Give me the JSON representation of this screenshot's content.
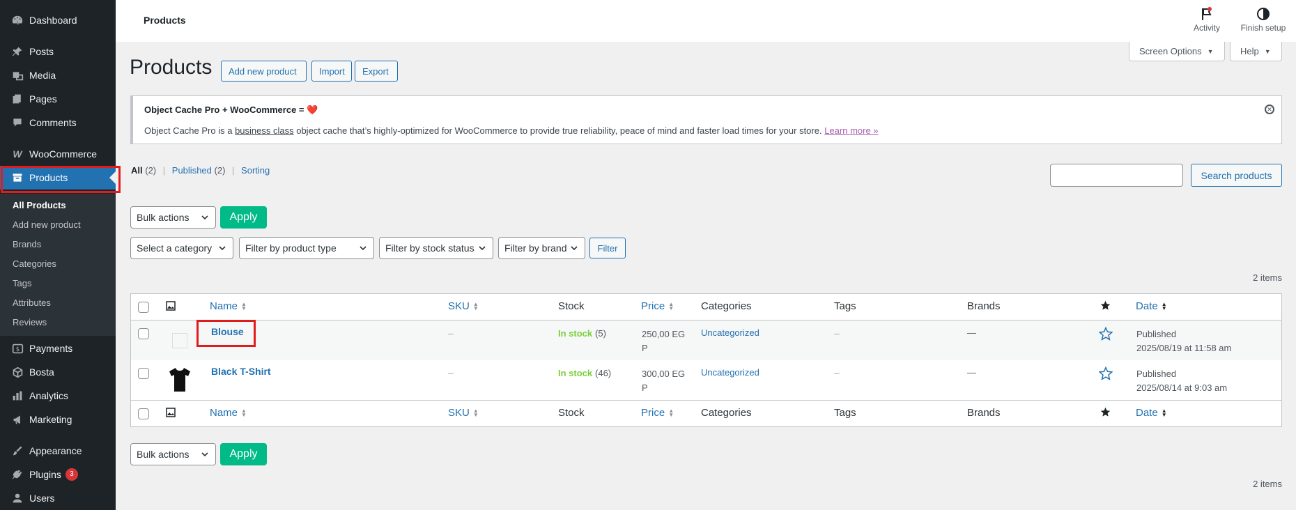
{
  "sidebar": {
    "items": [
      {
        "label": "Dashboard",
        "icon": "dashboard-icon"
      },
      {
        "label": "Posts",
        "icon": "pin-icon"
      },
      {
        "label": "Media",
        "icon": "media-icon"
      },
      {
        "label": "Pages",
        "icon": "pages-icon"
      },
      {
        "label": "Comments",
        "icon": "comment-icon"
      },
      {
        "label": "WooCommerce",
        "icon": "woocommerce-icon"
      },
      {
        "label": "Products",
        "icon": "archive-icon"
      },
      {
        "label": "Payments",
        "icon": "payments-icon"
      },
      {
        "label": "Bosta",
        "icon": "box-icon"
      },
      {
        "label": "Analytics",
        "icon": "bar-chart-icon"
      },
      {
        "label": "Marketing",
        "icon": "megaphone-icon"
      },
      {
        "label": "Appearance",
        "icon": "brush-icon"
      },
      {
        "label": "Plugins",
        "icon": "plugin-icon",
        "badge": "3"
      },
      {
        "label": "Users",
        "icon": "user-icon"
      }
    ],
    "submenu": [
      "All Products",
      "Add new product",
      "Brands",
      "Categories",
      "Tags",
      "Attributes",
      "Reviews"
    ]
  },
  "topbar": {
    "title": "Products",
    "activity_label": "Activity",
    "finish_setup_label": "Finish setup"
  },
  "screen_options_label": "Screen Options",
  "help_label": "Help",
  "page": {
    "title": "Products",
    "add_new_label": "Add new product",
    "import_label": "Import",
    "export_label": "Export"
  },
  "notice": {
    "title": "Object Cache Pro + WooCommerce = ",
    "heart": "❤️",
    "text_before": "Object Cache Pro is a ",
    "text_underlined": "business class",
    "text_after": " object cache that’s highly-optimized for WooCommerce to provide true reliability, peace of mind and faster load times for your store. ",
    "link": "Learn more »"
  },
  "views": {
    "all_label": "All",
    "all_count": "(2)",
    "published_label": "Published",
    "published_count": "(2)",
    "sorting_label": "Sorting"
  },
  "search": {
    "button_label": "Search products",
    "value": ""
  },
  "bulk_actions_label": "Bulk actions",
  "apply_label": "Apply",
  "filters": {
    "category": "Select a category",
    "product_type": "Filter by product type",
    "stock_status": "Filter by stock status",
    "brand": "Filter by brand",
    "filter_label": "Filter"
  },
  "items_count": "2 items",
  "table": {
    "columns": {
      "name": "Name",
      "sku": "SKU",
      "stock": "Stock",
      "price": "Price",
      "categories": "Categories",
      "tags": "Tags",
      "brands": "Brands",
      "date": "Date"
    },
    "rows": [
      {
        "name": "Blouse",
        "sku": "–",
        "stock_status": "In stock",
        "stock_qty": "(5)",
        "price_line1": "250,00 EG",
        "price_line2": "P",
        "category": "Uncategorized",
        "tags": "–",
        "brands": "—",
        "date_status": "Published",
        "date": "2025/08/19 at 11:58 am"
      },
      {
        "name": "Black T-Shirt",
        "sku": "–",
        "stock_status": "In stock",
        "stock_qty": "(46)",
        "price_line1": "300,00 EG",
        "price_line2": "P",
        "category": "Uncategorized",
        "tags": "–",
        "brands": "—",
        "date_status": "Published",
        "date": "2025/08/14 at 9:03 am"
      }
    ]
  },
  "colors": {
    "sidebar_bg": "#1d2327",
    "accent": "#2271b1",
    "apply_green": "#00ba88",
    "in_stock": "#7ad03a",
    "highlight_red": "#e01d1d"
  }
}
